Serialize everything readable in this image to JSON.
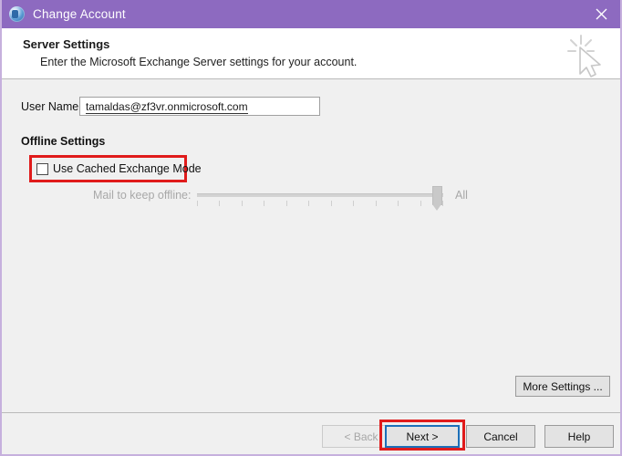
{
  "window": {
    "title": "Change Account",
    "title_icon": "outlook-account-icon",
    "close_icon": "close-icon",
    "titlebar_color": "#8d6ac0",
    "body_color": "#f0f0f0"
  },
  "header": {
    "title": "Server Settings",
    "subtitle": "Enter the Microsoft Exchange Server settings for your account.",
    "watermark_icon": "click-cursor-icon"
  },
  "form": {
    "username_label": "User Name:",
    "username_value": "tamaldas@zf3vr.onmicrosoft.com",
    "username_placeholder": "User Name"
  },
  "offline": {
    "section_label": "Offline Settings",
    "checkbox_label": "Use Cached Exchange Mode",
    "checkbox_checked": false,
    "slider_label": "Mail to keep offline:",
    "slider_max_label": "All",
    "slider_enabled": false,
    "slider_tick_count": 12,
    "slider_value_percent": 100
  },
  "buttons": {
    "more_settings": "More Settings ...",
    "back": "< Back",
    "next": "Next >",
    "cancel": "Cancel",
    "help": "Help"
  },
  "annotations": {
    "highlight_color": "#e01b1b",
    "focus_color": "#1c6fb8"
  }
}
